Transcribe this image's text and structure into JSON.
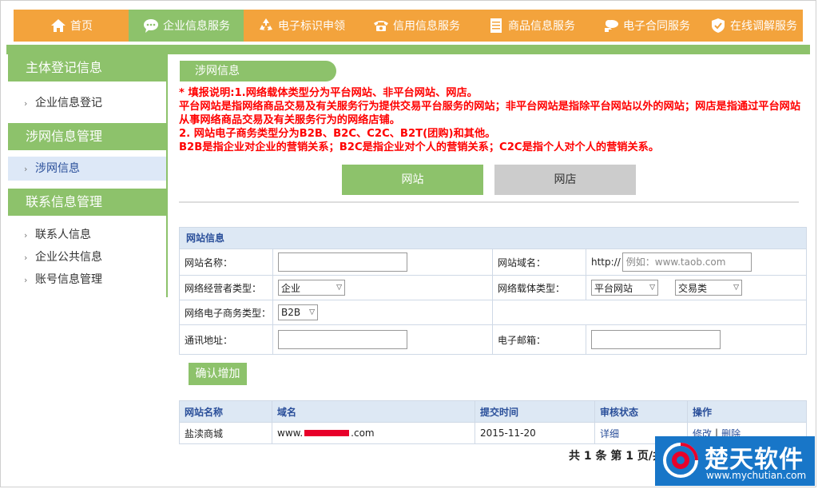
{
  "nav": {
    "items": [
      {
        "label": "首页",
        "icon": "home-icon"
      },
      {
        "label": "企业信息服务",
        "icon": "chat-bubble-icon"
      },
      {
        "label": "电子标识申领",
        "icon": "recycle-icon"
      },
      {
        "label": "信用信息服务",
        "icon": "telephone-icon"
      },
      {
        "label": "商品信息服务",
        "icon": "document-list-icon"
      },
      {
        "label": "电子合同服务",
        "icon": "cloud-hand-icon"
      },
      {
        "label": "在线调解服务",
        "icon": "shield-check-icon"
      }
    ],
    "active_index": 1
  },
  "sidebar": {
    "sections": [
      {
        "title": "主体登记信息",
        "items": [
          "企业信息登记"
        ]
      },
      {
        "title": "涉网信息管理",
        "items": [
          "涉网信息"
        ]
      },
      {
        "title": "联系信息管理",
        "items": [
          "联系人信息",
          "企业公共信息",
          "账号信息管理"
        ]
      }
    ],
    "active_item": "涉网信息"
  },
  "main": {
    "tab_label": "涉网信息",
    "notice": [
      "* 填报说明:1.网络载体类型分为平台网站、非平台网站、网店。",
      "平台网站是指网络商品交易及有关服务行为提供交易平台服务的网站；非平台网站是指除平台网站以外的网站；网店是指通过平台网站从事网络商品交易及有关服务行为的网络店铺。",
      "2. 网站电子商务类型分为B2B、B2C、C2C、B2T(团购)和其他。",
      "B2B是指企业对企业的营销关系；B2C是指企业对个人的营销关系；C2C是指个人对个人的营销关系。"
    ],
    "segments": {
      "website": "网站",
      "shop": "网店"
    },
    "form": {
      "title": "网站信息",
      "site_name_label": "网站名称：",
      "site_name_value": "",
      "domain_label": "网站域名：",
      "domain_prefix": "http://",
      "domain_placeholder": "例如：www.taob.com",
      "operator_type_label": "网络经营者类型：",
      "operator_type_value": "企业",
      "carrier_type_label": "网络载体类型：",
      "carrier_type_value": "平台网站",
      "carrier_subtype_value": "交易类",
      "ecommerce_type_label": "网络电子商务类型：",
      "ecommerce_type_value": "B2B",
      "address_label": "通讯地址：",
      "address_value": "",
      "email_label": "电子邮箱：",
      "email_value": ""
    },
    "confirm_button": "确认增加",
    "table": {
      "columns": [
        "网站名称",
        "域名",
        "提交时间",
        "审核状态",
        "操作"
      ],
      "rows": [
        {
          "name": "盐渎商城",
          "domain_prefix": "www.",
          "domain_suffix": ".com",
          "submitted": "2015-11-20",
          "status": "详细",
          "edit": "修改",
          "sep": "|",
          "delete": "删除"
        }
      ]
    },
    "pager": "共 1 条 第 1 页/共"
  },
  "watermark": {
    "name": "楚天软件",
    "url": "www.mychutian.com"
  },
  "colors": {
    "nav_orange": "#f3a33c",
    "accent_green": "#8dc26b",
    "notice_red": "#ff0000",
    "header_blue_bg": "#dde8f4",
    "link_blue": "#2a4f9a",
    "watermark_blue": "#1876c8"
  }
}
